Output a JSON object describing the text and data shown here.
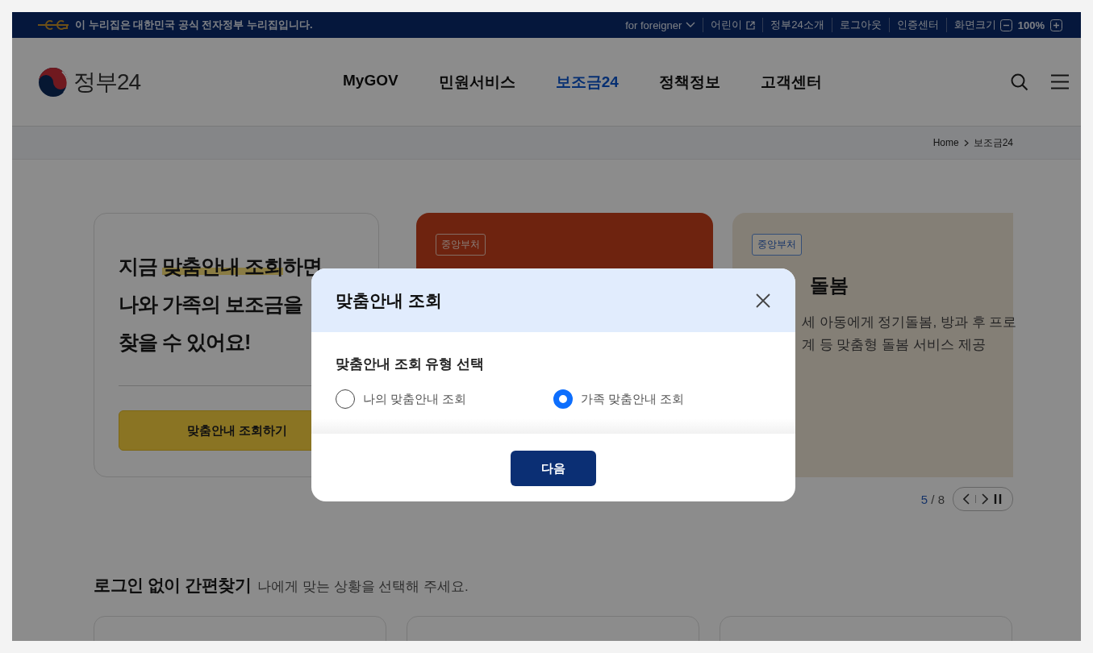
{
  "top_bar": {
    "notice": "이 누리집은 대한민국 공식 전자정부 누리집입니다.",
    "links": [
      {
        "label": "for foreigner",
        "kind": "dropdown"
      },
      {
        "label": "어린이",
        "kind": "external"
      },
      {
        "label": "정부24소개",
        "kind": "plain"
      },
      {
        "label": "로그아웃",
        "kind": "plain"
      },
      {
        "label": "인증센터",
        "kind": "plain"
      },
      {
        "label": "화면크기",
        "kind": "zoom"
      }
    ],
    "zoom_level": "100%"
  },
  "header": {
    "logo_text": "정부24",
    "nav": [
      {
        "label": "MyGOV",
        "selected": false
      },
      {
        "label": "민원서비스",
        "selected": false
      },
      {
        "label": "보조금24",
        "selected": true
      },
      {
        "label": "정책정보",
        "selected": false
      },
      {
        "label": "고객센터",
        "selected": false
      }
    ]
  },
  "breadcrumb": [
    "Home",
    "보조금24"
  ],
  "promo": {
    "heading_lines": [
      [
        {
          "text": "지금 ",
          "highlight": false
        },
        {
          "text": "맞춤안내 조회",
          "highlight": true
        },
        {
          "text": "하면",
          "highlight": false
        }
      ],
      [
        {
          "text": "나와 가족의 보조금을",
          "highlight": false
        }
      ],
      [
        {
          "text": "찾을 수 있어요!",
          "highlight": false
        }
      ]
    ],
    "button": "맞춤안내 조회하기"
  },
  "slides": [
    {
      "tag": "중앙부처",
      "kind": "dark"
    },
    {
      "tag": "중앙부처",
      "kind": "light",
      "title": "돌봄",
      "description_lines": [
        "세 아동에게 정기돌봄, 방과 후 프로",
        "계 등 맞춤형 돌봄 서비스 제공"
      ]
    }
  ],
  "pager": {
    "current": "5",
    "separator": "/",
    "total": "8"
  },
  "quick_find": {
    "title": "로그인 없이 간편찾기",
    "subtitle": "나에게 맞는 상황을 선택해 주세요."
  },
  "modal": {
    "title": "맞춤안내 조회",
    "question": "맞춤안내 조회 유형 선택",
    "options": [
      {
        "label": "나의 맞춤안내 조회",
        "selected": false
      },
      {
        "label": "가족 맞춤안내 조회",
        "selected": true
      }
    ],
    "next_button": "다음"
  }
}
